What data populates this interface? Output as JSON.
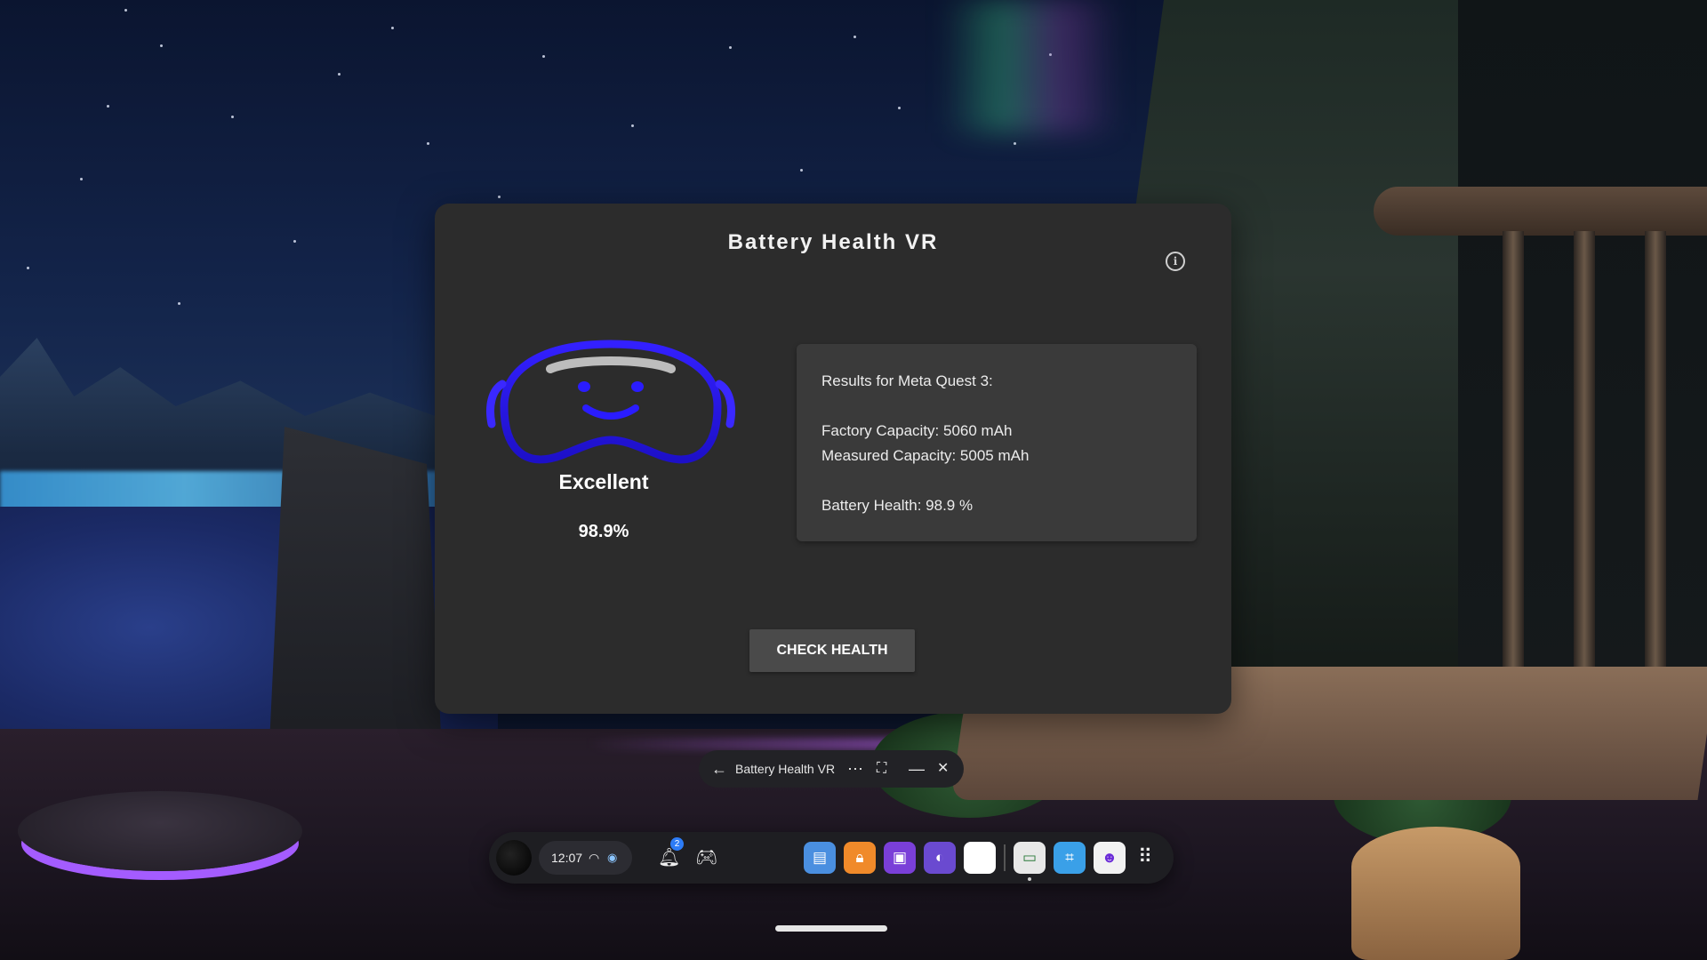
{
  "app": {
    "title": "Battery Health VR",
    "info_icon": "info-icon",
    "status": {
      "label": "Excellent",
      "percent_text": "98.9%",
      "headset_color": "#2a1cff"
    },
    "results": {
      "heading": "Results for Meta Quest 3:",
      "factory_capacity": "Factory Capacity: 5060 mAh",
      "measured_capacity": "Measured Capacity: 5005 mAh",
      "battery_health": "Battery Health: 98.9 %"
    },
    "check_button_label": "CHECK HEALTH"
  },
  "window_bar": {
    "back_icon": "back-arrow-icon",
    "title": "Battery Health VR",
    "more_icon": "more-icon",
    "expand_icon": "expand-icon",
    "minimize_icon": "minimize-icon",
    "close_icon": "close-icon"
  },
  "taskbar": {
    "time": "12:07",
    "notification_count": "2",
    "apps": [
      {
        "icon": "store-icon",
        "color": "#4a8fe0"
      },
      {
        "icon": "lock-app-icon",
        "color": "#f08a2a"
      },
      {
        "icon": "chat-app-icon",
        "color": "#7a3fd8"
      },
      {
        "icon": "meta-app-icon",
        "color": "#6a4ad0"
      },
      {
        "icon": "white-app-icon",
        "color": "#ffffff"
      },
      {
        "icon": "battery-health-app-icon",
        "color": "#e8e8e8"
      },
      {
        "icon": "scan-app-icon",
        "color": "#3aa0e8"
      },
      {
        "icon": "character-app-icon",
        "color": "#f2f2f2"
      }
    ]
  }
}
